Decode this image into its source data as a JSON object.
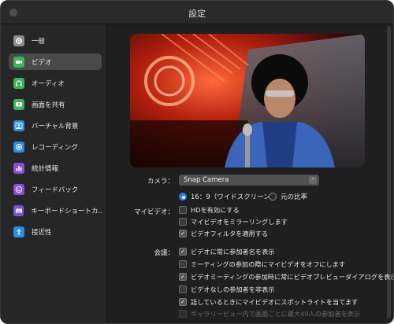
{
  "window": {
    "title": "設定"
  },
  "sidebar": {
    "items": [
      {
        "label": "一般",
        "icon": "gear-icon",
        "color": "#8e8e8e",
        "active": false
      },
      {
        "label": "ビデオ",
        "icon": "video-camera-icon",
        "color": "#3cb25a",
        "active": true
      },
      {
        "label": "オーディオ",
        "icon": "headphones-icon",
        "color": "#3cb25a",
        "active": false
      },
      {
        "label": "画面を共有",
        "icon": "share-screen-icon",
        "color": "#3cb25a",
        "active": false
      },
      {
        "label": "バーチャル背景",
        "icon": "person-background-icon",
        "color": "#2a8de8",
        "active": false
      },
      {
        "label": "レコーディング",
        "icon": "record-icon",
        "color": "#2a8de8",
        "active": false
      },
      {
        "label": "統計情報",
        "icon": "bar-chart-icon",
        "color": "#8a4fd8",
        "active": false
      },
      {
        "label": "フィードバック",
        "icon": "smile-icon",
        "color": "#8a4fd8",
        "active": false
      },
      {
        "label": "キーボードショートカ...",
        "icon": "keyboard-icon",
        "color": "#7a55d6",
        "active": false
      },
      {
        "label": "接近性",
        "icon": "accessibility-icon",
        "color": "#2a8de8",
        "active": false
      }
    ]
  },
  "camera": {
    "label": "カメラ：",
    "selected": "Snap Camera"
  },
  "my_video": {
    "label": "マイビデオ：",
    "aspect_options": [
      {
        "label": "16：9（ワイドスクリーン）",
        "selected": true
      },
      {
        "label": "元の比率",
        "selected": false
      }
    ],
    "options": [
      {
        "label": "HDを有効にする",
        "checked": false
      },
      {
        "label": "マイビデオをミラーリングします",
        "checked": false
      },
      {
        "label": "ビデオフィルタを適用する",
        "checked": true
      }
    ]
  },
  "meeting": {
    "label": "会議：",
    "options": [
      {
        "label": "ビデオに常に参加者名を表示",
        "checked": true,
        "enabled": true
      },
      {
        "label": "ミーティングの参加の際にマイビデオをオフにします",
        "checked": false,
        "enabled": true
      },
      {
        "label": "ビデオミーティングの参加時に常にビデオプレビューダイアログを表示",
        "checked": true,
        "enabled": true
      },
      {
        "label": "ビデオなしの参加者を非表示",
        "checked": false,
        "enabled": true
      },
      {
        "label": "話しているときにマイビデオにスポットライトを当てます",
        "checked": true,
        "enabled": true
      },
      {
        "label": "ギャラリービュー内で画面ごとに最大49人の参加者を表示",
        "checked": false,
        "enabled": false
      }
    ]
  }
}
